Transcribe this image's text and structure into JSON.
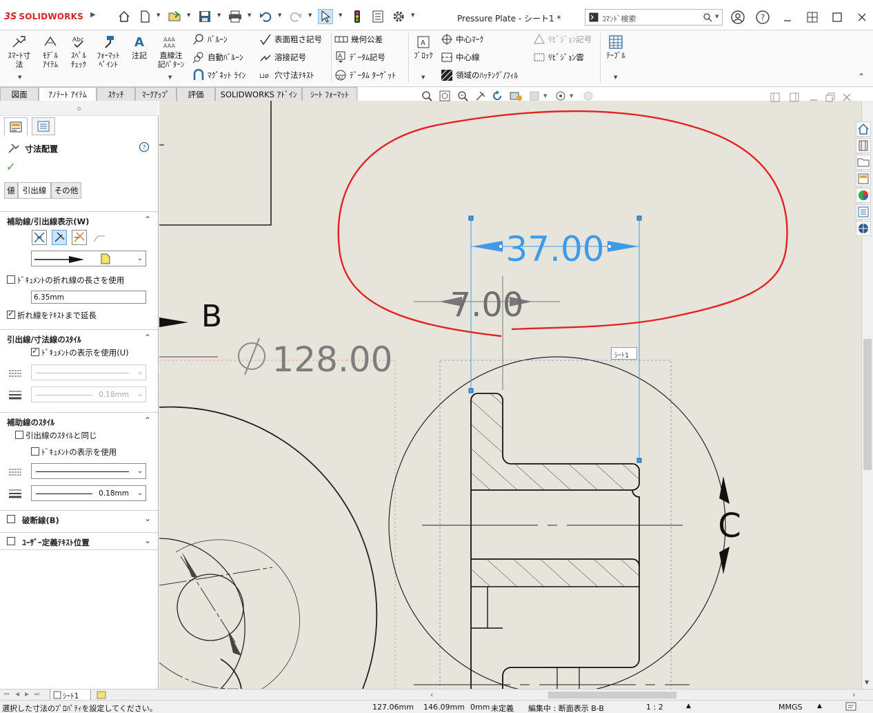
{
  "app": {
    "brand_ds": "3S",
    "brand_name": "SOLIDWORKS",
    "document_title": "Pressure Plate - シート1 *",
    "command_search_placeholder": "ｺﾏﾝﾄﾞ検索"
  },
  "ribbon": {
    "smart_dimension": "ｽﾏｰﾄ寸\n法",
    "model_items": "ﾓﾃﾞﾙ\nｱｲﾃﾑ",
    "spell_check": "ｽﾍﾟﾙ\nﾁｪｯｸ",
    "format_painter": "ﾌｫｰﾏｯﾄ\nﾍﾟｲﾝﾄ",
    "note": "注記",
    "linear_note_pattern": "直線注\n記ﾊﾟﾀｰﾝ",
    "balloon": "ﾊﾞﾙｰﾝ",
    "auto_balloon": "自動ﾊﾞﾙｰﾝ",
    "magnetic_line": "ﾏｸﾞﾈｯﾄ ﾗｲﾝ",
    "surface_finish": "表面粗さ記号",
    "weld_symbol": "溶接記号",
    "hole_callout": "穴寸法ﾃｷｽﾄ",
    "geometric_tolerance": "幾何公差",
    "datum_feature": "ﾃﾞｰﾀﾑ記号",
    "datum_target": "ﾃﾞｰﾀﾑ ﾀｰｹﾞｯﾄ",
    "blocks": "ﾌﾞﾛｯｸ",
    "center_mark": "中心ﾏｰｸ",
    "centerline": "中心線",
    "area_hatch": "領域のﾊｯﾁﾝｸﾞ/ﾌｨﾙ",
    "revision_symbol": "ﾘﾋﾞｼﾞｮﾝ記号",
    "revision_cloud": "ﾘﾋﾞｼﾞｮﾝ雲",
    "tables": "ﾃｰﾌﾞﾙ"
  },
  "command_tabs": [
    "図面",
    "ｱﾉﾃｰﾄ ｱｲﾃﾑ",
    "ｽｹｯﾁ",
    "ﾏｰｸｱｯﾌﾟ",
    "評価",
    "SOLIDWORKS ｱﾄﾞｲﾝ",
    "ｼｰﾄ ﾌｫｰﾏｯﾄ"
  ],
  "property_manager": {
    "title": "寸法配置",
    "tabs": [
      "値",
      "引出線",
      "その他"
    ],
    "witness_section": {
      "title": "補助線/引出線表示(W)",
      "use_doc_bend_length": "ﾄﾞｷｭﾒﾝﾄの折れ線の長さを使用",
      "bend_length_value": "6.35mm",
      "extend_bent_to_text": "折れ線をﾃｷｽﾄまで延長"
    },
    "leader_style_section": {
      "title": "引出線/寸法線のｽﾀｲﾙ",
      "use_doc_display": "ﾄﾞｷｭﾒﾝﾄの表示を使用(U)",
      "thickness_value": "0.18mm"
    },
    "extension_style_section": {
      "title": "補助線のｽﾀｲﾙ",
      "same_as_leader": "引出線のｽﾀｲﾙと同じ",
      "use_doc_display": "ﾄﾞｷｭﾒﾝﾄの表示を使用",
      "thickness_value": "0.18mm"
    },
    "break_lines_section": {
      "title": "破断線(B)"
    },
    "custom_text_section": {
      "title": "ﾕｰｻﾞｰ定義ﾃｷｽﾄ位置"
    }
  },
  "drawing": {
    "dim_selected": "37.00",
    "dim_secondary": "7.00",
    "dim_diameter": "128.00",
    "section_label_b": "B",
    "section_label_c": "C",
    "sheet_tooltip": "ｼｰﾄ1",
    "selected_color": "#3d9be9",
    "markup_color": "#e32222"
  },
  "sheet_tabs": {
    "active": "ｼｰﾄ1"
  },
  "status": {
    "message": "選択した寸法のﾌﾟﾛﾊﾟﾃｨを設定してください。",
    "x": "127.06mm",
    "y": "146.09mm",
    "z": "0mm",
    "state": "未定義",
    "editing": "編集中 : 断面表示 B-B",
    "scale": "1 : 2",
    "units": "MMGS"
  }
}
